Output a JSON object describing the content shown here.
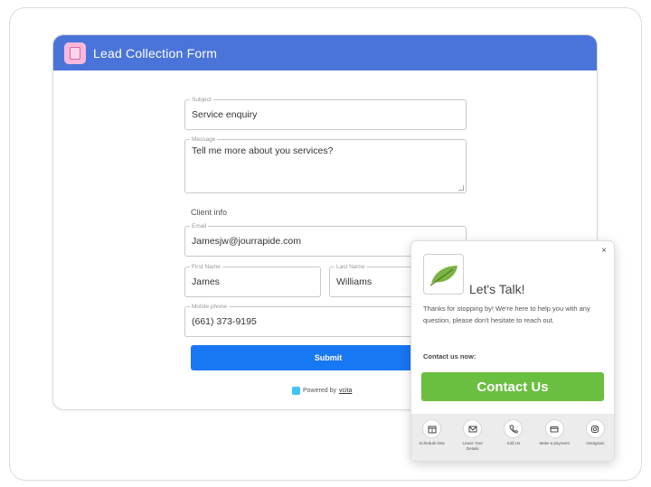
{
  "form": {
    "title": "Lead Collection Form",
    "subject": {
      "label": "Subject",
      "value": "Service enquiry"
    },
    "message": {
      "label": "Message",
      "value": "Tell me more about you services?"
    },
    "client_info_label": "Client info",
    "email": {
      "label": "Email",
      "value": "Jamesjw@jourrapide.com"
    },
    "first_name": {
      "label": "First Name",
      "value": "James"
    },
    "last_name": {
      "label": "Last Name",
      "value": "Williams"
    },
    "mobile_phone": {
      "label": "Mobile phone",
      "value": "(661) 373-9195"
    },
    "submit_label": "Submit",
    "powered_by": "Powered by",
    "powered_brand": "vcita"
  },
  "widget": {
    "close_label": "×",
    "title": "Let's Talk!",
    "body": "Thanks for stopping by! We're here to help you with any question, please don't hesitate to reach out.",
    "contact_now": "Contact us now:",
    "contact_button": "Contact Us",
    "actions": [
      {
        "label": "Schedule time",
        "icon": "calendar-icon"
      },
      {
        "label": "Leave Your Details",
        "icon": "envelope-icon"
      },
      {
        "label": "Call Us",
        "icon": "phone-icon"
      },
      {
        "label": "Make a payment",
        "icon": "card-icon"
      },
      {
        "label": "Instagram",
        "icon": "instagram-icon"
      }
    ]
  },
  "colors": {
    "header": "#4a74d9",
    "submit": "#1877f2",
    "contact": "#6abf40"
  }
}
